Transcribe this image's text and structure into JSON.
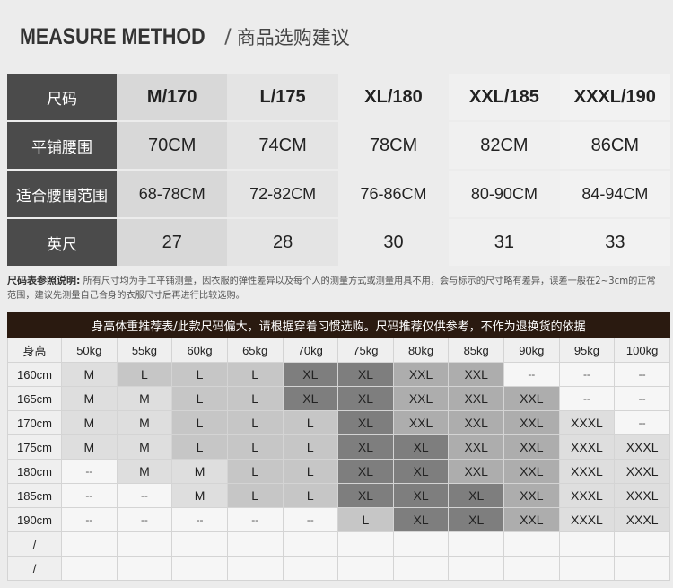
{
  "header": {
    "title_en": "MEASURE METHOD",
    "separator": "/",
    "title_cn": "商品选购建议"
  },
  "size_table": {
    "rows": [
      {
        "label": "尺码",
        "cells": [
          "M/170",
          "L/175",
          "XL/180",
          "XXL/185",
          "XXXL/190"
        ]
      },
      {
        "label": "平铺腰围",
        "cells": [
          "70CM",
          "74CM",
          "78CM",
          "82CM",
          "86CM"
        ]
      },
      {
        "label": "适合腰围范围",
        "cells": [
          "68-78CM",
          "72-82CM",
          "76-86CM",
          "80-90CM",
          "84-94CM"
        ]
      },
      {
        "label": "英尺",
        "cells": [
          "27",
          "28",
          "30",
          "31",
          "33"
        ]
      }
    ]
  },
  "note": {
    "title": "尺码表参照说明:",
    "text": "所有尺寸均为手工平铺测量，因衣服的弹性差异以及每个人的测量方式或测量用具不用，会与标示的尺寸略有差异，误差一般在2~3cm的正常范围，建议先测量自己合身的衣服尺寸后再进行比较选购。"
  },
  "recommend": {
    "title": "身高体重推荐表/此款尺码偏大，请根据穿着习惯选购。尺码推荐仅供参考，不作为退换货的依据",
    "corner": "身高",
    "weights": [
      "50kg",
      "55kg",
      "60kg",
      "65kg",
      "70kg",
      "75kg",
      "80kg",
      "85kg",
      "90kg",
      "95kg",
      "100kg"
    ],
    "rows": [
      {
        "height": "160cm",
        "sizes": [
          "M",
          "L",
          "L",
          "L",
          "XL",
          "XL",
          "XXL",
          "XXL",
          "--",
          "--",
          "--"
        ]
      },
      {
        "height": "165cm",
        "sizes": [
          "M",
          "M",
          "L",
          "L",
          "XL",
          "XL",
          "XXL",
          "XXL",
          "XXL",
          "--",
          "--"
        ]
      },
      {
        "height": "170cm",
        "sizes": [
          "M",
          "M",
          "L",
          "L",
          "L",
          "XL",
          "XXL",
          "XXL",
          "XXL",
          "XXXL",
          "--"
        ]
      },
      {
        "height": "175cm",
        "sizes": [
          "M",
          "M",
          "L",
          "L",
          "L",
          "XL",
          "XL",
          "XXL",
          "XXL",
          "XXXL",
          "XXXL"
        ]
      },
      {
        "height": "180cm",
        "sizes": [
          "--",
          "M",
          "M",
          "L",
          "L",
          "XL",
          "XL",
          "XXL",
          "XXL",
          "XXXL",
          "XXXL"
        ]
      },
      {
        "height": "185cm",
        "sizes": [
          "--",
          "--",
          "M",
          "L",
          "L",
          "XL",
          "XL",
          "XL",
          "XXL",
          "XXXL",
          "XXXL"
        ]
      },
      {
        "height": "190cm",
        "sizes": [
          "--",
          "--",
          "--",
          "--",
          "--",
          "L",
          "XL",
          "XL",
          "XXL",
          "XXXL",
          "XXXL"
        ]
      },
      {
        "height": "/",
        "sizes": [
          "",
          "",
          "",
          "",
          "",
          "",
          "",
          "",
          "",
          "",
          ""
        ]
      },
      {
        "height": "/",
        "sizes": [
          "",
          "",
          "",
          "",
          "",
          "",
          "",
          "",
          "",
          "",
          ""
        ]
      }
    ],
    "colors": {
      "M": "#dedede",
      "L": "#c6c6c6",
      "XL": "#939393",
      "XXL": "#c6c6c6",
      "XXXL": "#dedede"
    }
  }
}
